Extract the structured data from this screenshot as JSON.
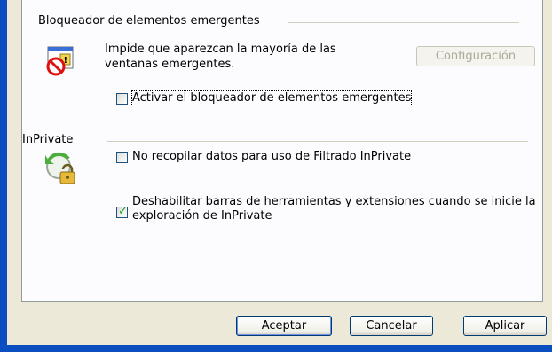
{
  "popup_blocker": {
    "section_title": "Bloqueador de elementos emergentes",
    "description": "Impide que aparezcan la mayoría de las ventanas emergentes.",
    "settings_button": "Configuración",
    "enable_checkbox": {
      "label": "Activar el bloqueador de elementos emergentes",
      "checked": false
    }
  },
  "inprivate": {
    "section_title": "InPrivate",
    "no_collect_checkbox": {
      "label": "No recopilar datos para uso de Filtrado InPrivate",
      "checked": false
    },
    "disable_toolbars_checkbox": {
      "label": "Deshabilitar barras de herramientas y extensiones cuando se inicie la exploración de InPrivate",
      "checked": true
    }
  },
  "footer": {
    "ok_button": "Aceptar",
    "cancel_button": "Cancelar",
    "apply_button": "Aplicar"
  },
  "colors": {
    "window_frame": "#0a4ec0",
    "dialog_bg": "#ece9d8",
    "tab_panel_bg": "#fcfcfe",
    "checkmark": "#21a121"
  },
  "icons": {
    "popup_blocker": "popup-blocker-icon",
    "inprivate": "inprivate-lock-icon"
  }
}
